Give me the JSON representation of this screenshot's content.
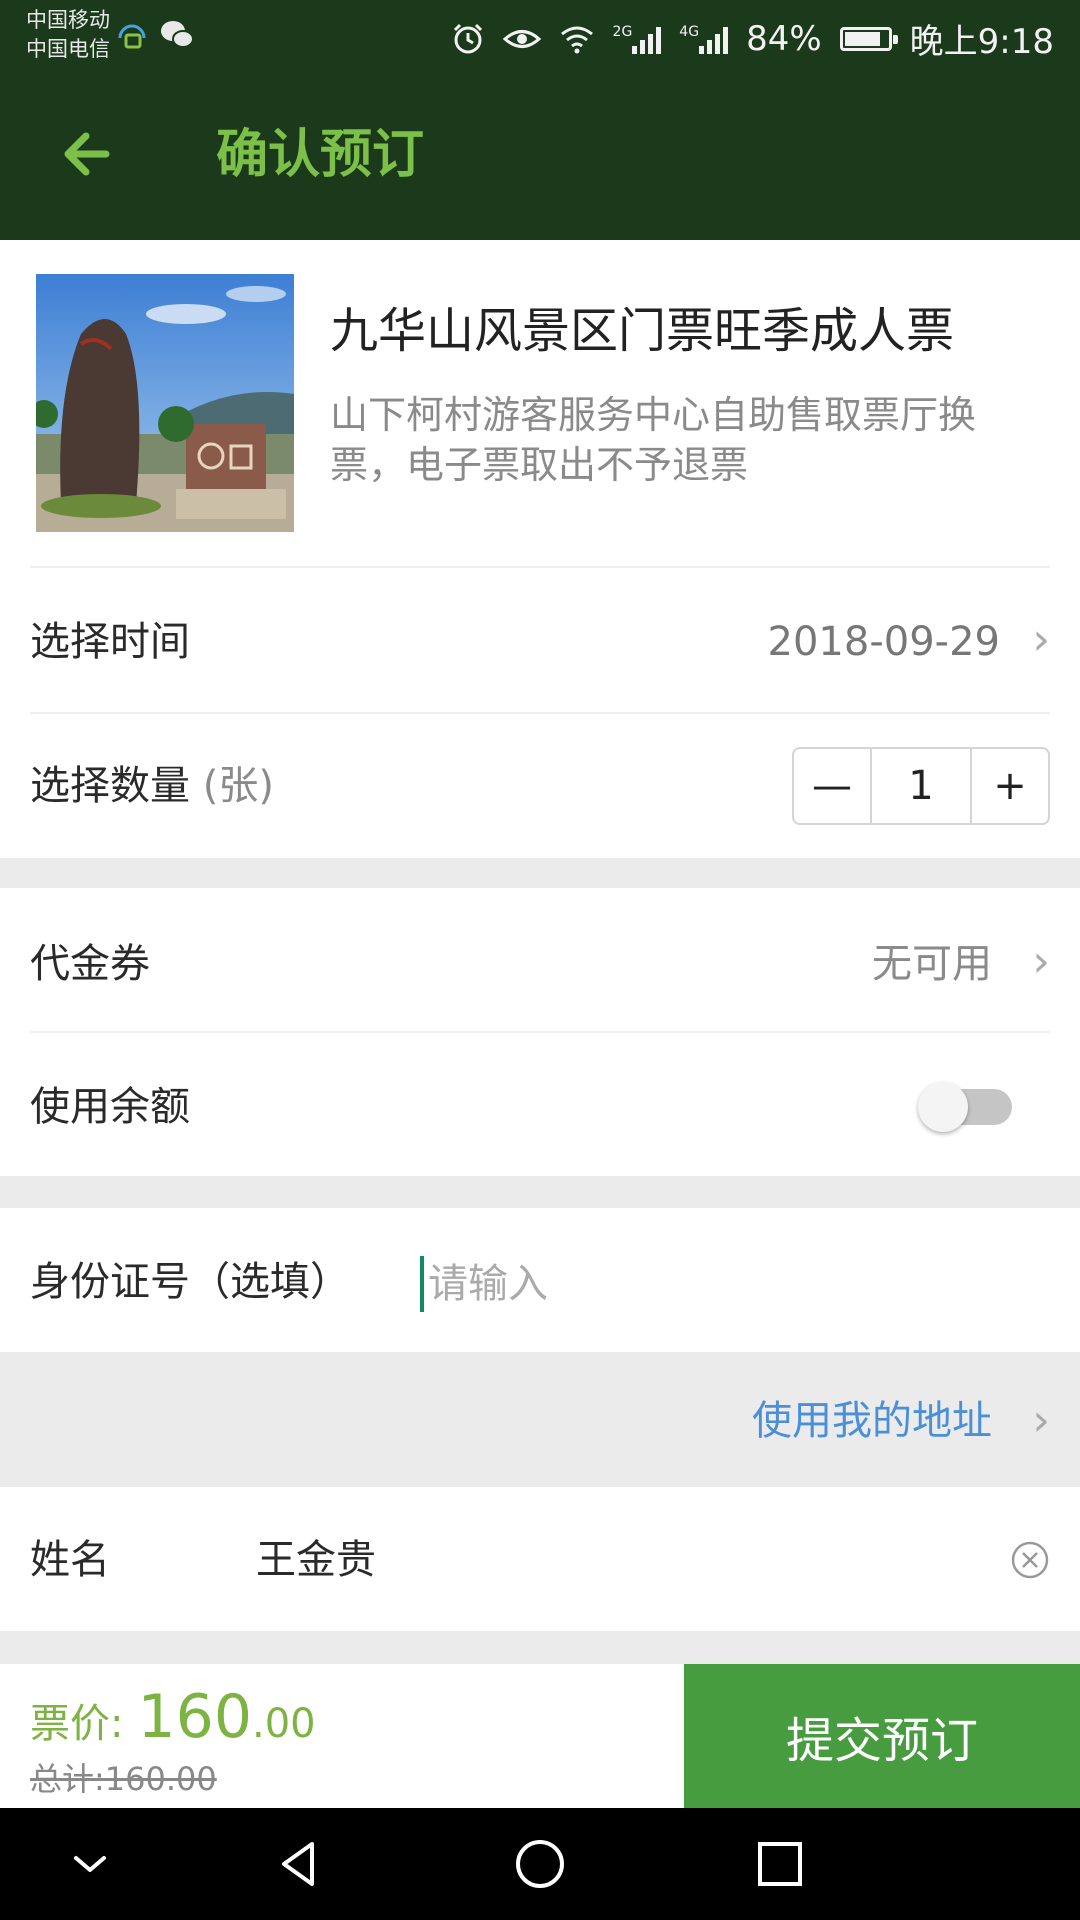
{
  "status_bar": {
    "carrier_1": "中国移动",
    "carrier_2": "中国电信",
    "network_2g": "2G",
    "network_4g": "4G",
    "battery": "84%",
    "battery_level": 0.84,
    "time": "晚上9:18"
  },
  "header": {
    "title": "确认预订",
    "back_icon": "arrow-left-icon"
  },
  "product": {
    "title": "九华山风景区门票旺季成人票",
    "description": "山下柯村游客服务中心自助售取票厅换票，电子票取出不予退票"
  },
  "date_row": {
    "label": "选择时间",
    "value": "2018-09-29"
  },
  "quantity_row": {
    "label": "选择数量",
    "unit": "(张)",
    "minus": "—",
    "value": "1",
    "plus": "+"
  },
  "voucher_row": {
    "label": "代金券",
    "value": "无可用"
  },
  "balance_row": {
    "label": "使用余额",
    "enabled": false
  },
  "id_row": {
    "label": "身份证号（选填）",
    "placeholder": "请输入"
  },
  "address_link": {
    "label": "使用我的地址"
  },
  "name_row": {
    "label": "姓名",
    "value": "王金贵",
    "clear_icon": "clear-circle-icon"
  },
  "footer": {
    "price_label": "票价:",
    "price_int": "160",
    "price_dec": ".00",
    "total": "总计:160.00",
    "submit": "提交预订"
  },
  "colors": {
    "header_bg": "#1b3a1b",
    "accent_green": "#7cc04a",
    "submit_green": "#479c3f",
    "price_green": "#7cb342",
    "link_blue": "#4a90d9"
  }
}
